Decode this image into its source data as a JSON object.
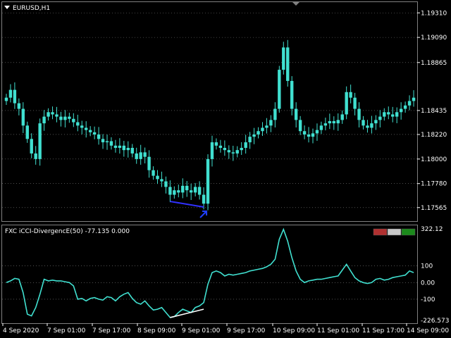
{
  "main_panel": {
    "symbol_label": "EURUSD,H1",
    "price_ticks": [
      "1.19310",
      "1.19090",
      "1.18865",
      "1.18435",
      "1.18220",
      "1.18000",
      "1.17780",
      "1.17565"
    ],
    "divergence_arrow": "up-arrow"
  },
  "indicator_panel": {
    "label": "FXC iCCI-DivergencE(50) -77.135 0.000",
    "value_ticks": [
      "322.12",
      "100",
      "0.00",
      "-100",
      "-226.573"
    ],
    "buttons": [
      {
        "name": "red-button",
        "color": "#b03030"
      },
      {
        "name": "grey-button",
        "color": "#c8c8c8"
      },
      {
        "name": "green-button",
        "color": "#1c8a1c"
      }
    ]
  },
  "time_axis": [
    "4 Sep 2020",
    "7 Sep 01:00",
    "7 Sep 17:00",
    "8 Sep 09:00",
    "9 Sep 01:00",
    "9 Sep 17:00",
    "10 Sep 09:00",
    "11 Sep 01:00",
    "11 Sep 17:00",
    "14 Sep 09:00"
  ],
  "colors": {
    "candle": "#40e0d0",
    "indicator_line": "#40e0d0",
    "divergence_price_line": "#3030ff",
    "divergence_indicator_line": "#ffffff",
    "arrow": "#2040ff",
    "grid": "#808080"
  },
  "chart_data": [
    {
      "type": "candlestick",
      "title": "EURUSD,H1",
      "ylim": [
        1.1745,
        1.194
      ],
      "x_ticks": [
        "4 Sep 2020",
        "7 Sep 01:00",
        "7 Sep 17:00",
        "8 Sep 09:00",
        "9 Sep 01:00",
        "9 Sep 17:00",
        "10 Sep 09:00",
        "11 Sep 01:00",
        "11 Sep 17:00",
        "14 Sep 09:00"
      ],
      "closes": [
        1.1855,
        1.1862,
        1.185,
        1.1845,
        1.183,
        1.1818,
        1.1805,
        1.18,
        1.1832,
        1.1838,
        1.1842,
        1.184,
        1.1838,
        1.1835,
        1.1838,
        1.1836,
        1.1833,
        1.183,
        1.1828,
        1.1826,
        1.1824,
        1.1822,
        1.1818,
        1.1815,
        1.1816,
        1.1812,
        1.181,
        1.1812,
        1.1808,
        1.181,
        1.1805,
        1.18,
        1.1806,
        1.1802,
        1.179,
        1.1785,
        1.1782,
        1.178,
        1.1775,
        1.1768,
        1.1772,
        1.177,
        1.1776,
        1.1772,
        1.177,
        1.1775,
        1.1768,
        1.176,
        1.18,
        1.1815,
        1.1812,
        1.181,
        1.1808,
        1.1806,
        1.1805,
        1.1808,
        1.181,
        1.1815,
        1.182,
        1.1822,
        1.1825,
        1.1828,
        1.183,
        1.1835,
        1.1845,
        1.188,
        1.19,
        1.187,
        1.1845,
        1.1835,
        1.1825,
        1.1822,
        1.182,
        1.1823,
        1.1826,
        1.183,
        1.1832,
        1.1834,
        1.1832,
        1.1835,
        1.184,
        1.186,
        1.1855,
        1.1845,
        1.1835,
        1.183,
        1.1828,
        1.1832,
        1.1835,
        1.1838,
        1.1842,
        1.184,
        1.1838,
        1.1842,
        1.1845,
        1.1848,
        1.1852,
        1.1855
      ],
      "divergence": {
        "from_index": 39,
        "to_index": 47,
        "arrow": "up"
      }
    },
    {
      "type": "line",
      "title": "FXC iCCI-DivergencE(50) -77.135 0.000",
      "ylim": [
        -240,
        340
      ],
      "y_ticks": [
        322.12,
        100,
        0,
        -100,
        -226.573
      ],
      "values": [
        0,
        10,
        25,
        20,
        -60,
        -190,
        -200,
        -150,
        -70,
        20,
        10,
        15,
        10,
        10,
        5,
        0,
        -20,
        -100,
        -95,
        -110,
        -95,
        -90,
        -100,
        -105,
        -85,
        -90,
        -110,
        -85,
        -70,
        -60,
        -95,
        -120,
        -130,
        -110,
        -140,
        -165,
        -160,
        -150,
        -180,
        -210,
        -205,
        -180,
        -160,
        -170,
        -180,
        -150,
        -140,
        -120,
        -10,
        60,
        70,
        60,
        40,
        50,
        45,
        50,
        55,
        60,
        70,
        75,
        80,
        85,
        95,
        110,
        140,
        260,
        320,
        250,
        150,
        70,
        20,
        0,
        10,
        15,
        20,
        20,
        25,
        30,
        35,
        40,
        75,
        110,
        70,
        30,
        10,
        0,
        -5,
        0,
        20,
        25,
        15,
        20,
        30,
        35,
        40,
        45,
        70,
        60
      ],
      "divergence": {
        "from_index": 39,
        "to_index": 47
      }
    }
  ]
}
